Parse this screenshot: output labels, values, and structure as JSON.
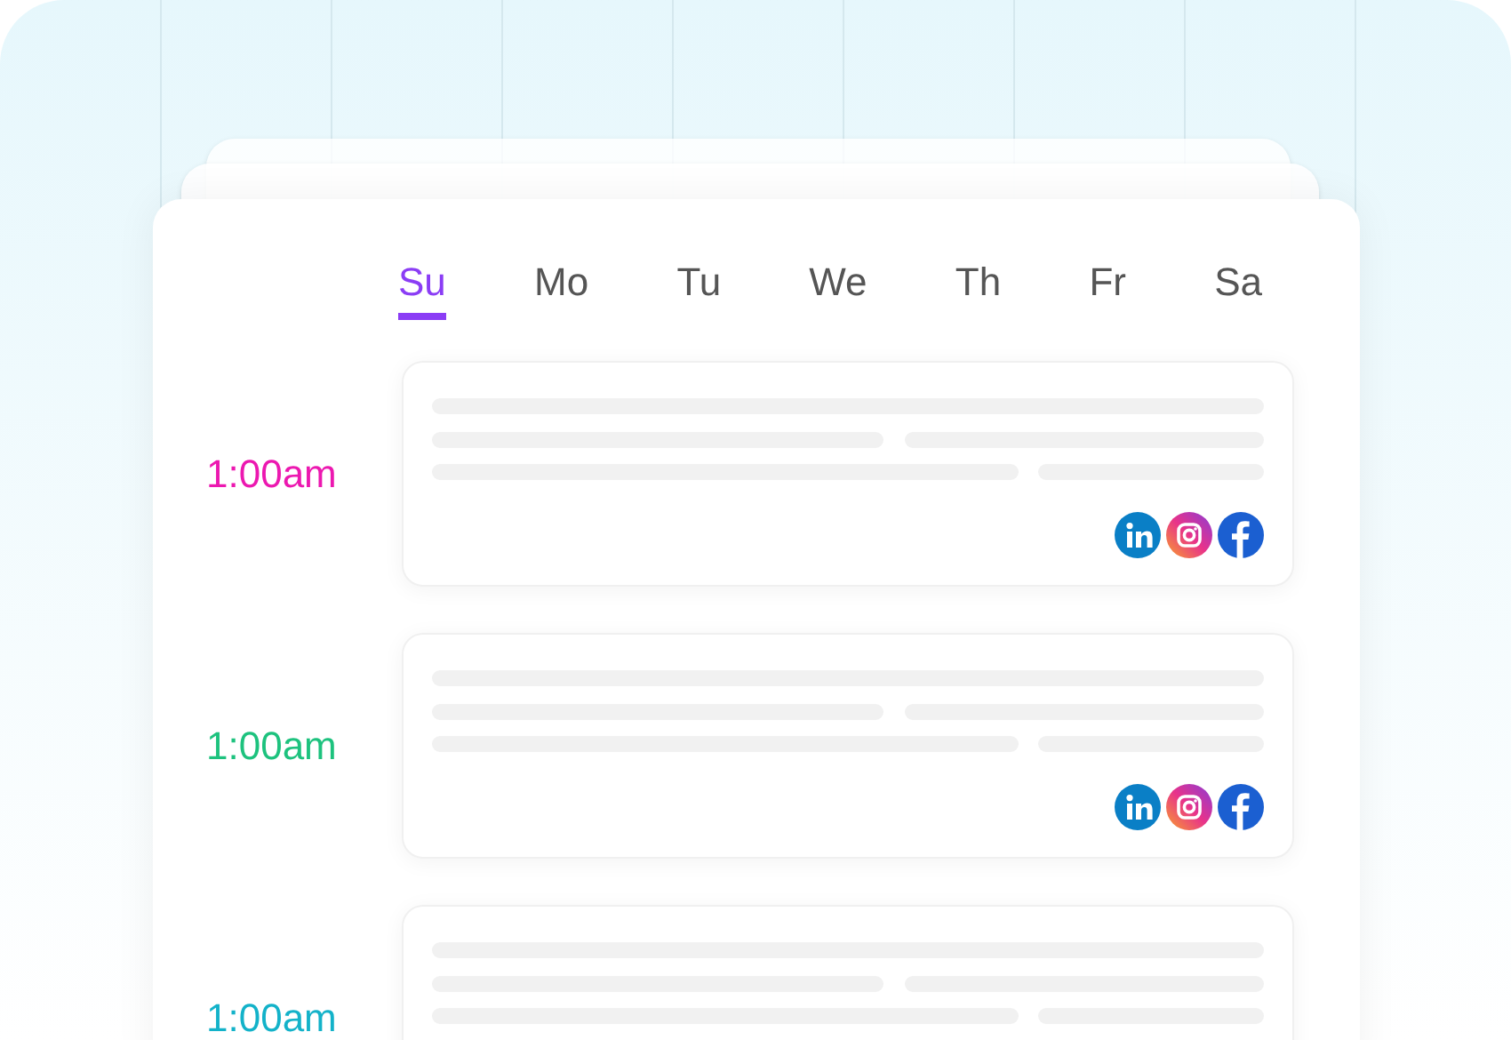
{
  "days": [
    {
      "label": "Su",
      "selected": true
    },
    {
      "label": "Mo",
      "selected": false
    },
    {
      "label": "Tu",
      "selected": false
    },
    {
      "label": "We",
      "selected": false
    },
    {
      "label": "Th",
      "selected": false
    },
    {
      "label": "Fr",
      "selected": false
    },
    {
      "label": "Sa",
      "selected": false
    }
  ],
  "slots": [
    {
      "time": "1:00am",
      "color": "#ec18b0",
      "networks": [
        {
          "kind": "linkedin"
        },
        {
          "kind": "instagram"
        },
        {
          "kind": "facebook"
        }
      ]
    },
    {
      "time": "1:00am",
      "color": "#1dc27e",
      "networks": [
        {
          "kind": "linkedin"
        },
        {
          "kind": "instagram"
        },
        {
          "kind": "facebook"
        }
      ]
    },
    {
      "time": "1:00am",
      "color": "#13b2c9"
    }
  ]
}
